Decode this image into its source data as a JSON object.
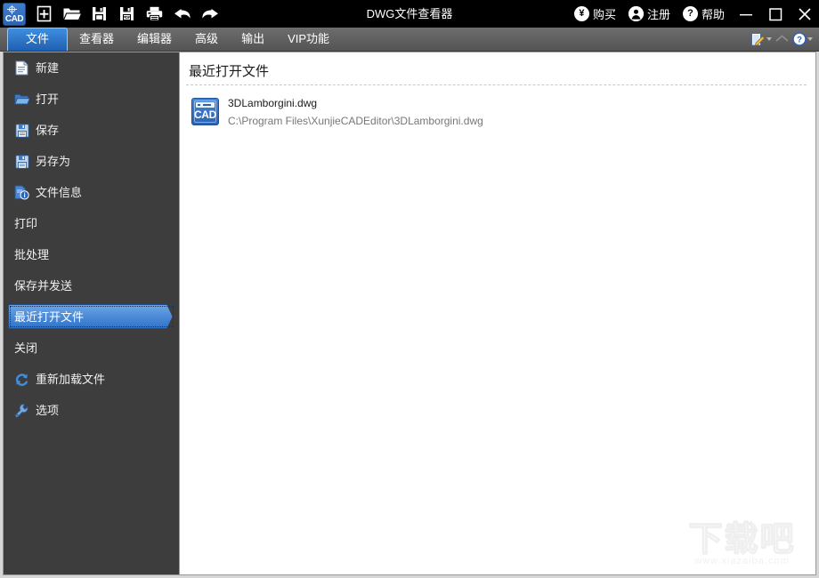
{
  "window": {
    "title": "DWG文件查看器",
    "logo_text": "CAD",
    "logo_name": "cad-app-logo"
  },
  "quick_access": [
    {
      "name": "new-file-button",
      "label": "新建",
      "icon": "new-document-icon"
    },
    {
      "name": "open-file-button",
      "label": "打开",
      "icon": "open-folder-icon"
    },
    {
      "name": "save-file-button",
      "label": "保存",
      "icon": "floppy-save-icon"
    },
    {
      "name": "save-pdf-button",
      "label": "保存为PDF",
      "icon": "floppy-pdf-icon"
    },
    {
      "name": "print-button",
      "label": "打印",
      "icon": "printer-icon"
    },
    {
      "name": "undo-button",
      "label": "撤销",
      "icon": "undo-arrow-icon"
    },
    {
      "name": "redo-button",
      "label": "重做",
      "icon": "redo-arrow-icon"
    }
  ],
  "titlebar_actions": [
    {
      "name": "purchase-button",
      "label": "购买",
      "icon": "yen-circle-icon"
    },
    {
      "name": "register-button",
      "label": "注册",
      "icon": "user-circle-icon"
    },
    {
      "name": "help-button",
      "label": "帮助",
      "icon": "question-circle-icon"
    }
  ],
  "window_controls": [
    {
      "name": "minimize-button",
      "icon": "minimize-icon"
    },
    {
      "name": "maximize-button",
      "icon": "maximize-icon"
    },
    {
      "name": "close-button",
      "icon": "close-icon"
    }
  ],
  "tabs": [
    {
      "name": "tab-file",
      "label": "文件",
      "active": true
    },
    {
      "name": "tab-viewer",
      "label": "查看器",
      "active": false
    },
    {
      "name": "tab-editor",
      "label": "编辑器",
      "active": false
    },
    {
      "name": "tab-advanced",
      "label": "高级",
      "active": false
    },
    {
      "name": "tab-output",
      "label": "输出",
      "active": false
    },
    {
      "name": "tab-vip",
      "label": "VIP功能",
      "active": false
    }
  ],
  "ribbon_right_icons": [
    {
      "name": "annotate-document-icon",
      "has_caret": true
    },
    {
      "name": "collapse-ribbon-chevron-icon",
      "has_caret": false
    },
    {
      "name": "help-question-icon",
      "has_caret": true
    }
  ],
  "sidebar": {
    "items": [
      {
        "name": "sidebar-item-new",
        "label": "新建",
        "icon": "new-document-icon",
        "selected": false
      },
      {
        "name": "sidebar-item-open",
        "label": "打开",
        "icon": "open-folder-icon",
        "selected": false
      },
      {
        "name": "sidebar-item-save",
        "label": "保存",
        "icon": "floppy-save-icon",
        "selected": false
      },
      {
        "name": "sidebar-item-save-as",
        "label": "另存为",
        "icon": "floppy-saveas-icon",
        "selected": false
      },
      {
        "name": "sidebar-item-file-info",
        "label": "文件信息",
        "icon": "document-info-icon",
        "selected": false
      },
      {
        "name": "sidebar-item-print",
        "label": "打印",
        "icon": "none",
        "selected": false
      },
      {
        "name": "sidebar-item-batch",
        "label": "批处理",
        "icon": "none",
        "selected": false
      },
      {
        "name": "sidebar-item-save-send",
        "label": "保存并发送",
        "icon": "none",
        "selected": false
      },
      {
        "name": "sidebar-item-recent",
        "label": "最近打开文件",
        "icon": "none",
        "selected": true
      },
      {
        "name": "sidebar-item-close",
        "label": "关闭",
        "icon": "none",
        "selected": false
      },
      {
        "name": "sidebar-item-reload",
        "label": "重新加载文件",
        "icon": "reload-icon",
        "selected": false
      },
      {
        "name": "sidebar-item-options",
        "label": "选项",
        "icon": "wrench-icon",
        "selected": false
      }
    ]
  },
  "main": {
    "title": "最近打开文件",
    "recent_files": [
      {
        "name": "3DLamborgini.dwg",
        "path": "C:\\Program Files\\XunjieCADEditor\\3DLamborgini.dwg",
        "icon_text": "CAD"
      }
    ]
  },
  "watermark": {
    "text": "下载吧",
    "url": "www.xiazaiba.com"
  },
  "colors": {
    "titlebar_bg": "#000000",
    "tabstrip_bg": "#5d5d5d",
    "tab_active": "#2f7fd0",
    "sidebar_bg": "#3d3d3d",
    "selection_blue": "#3f86dc",
    "content_bg": "#ffffff",
    "path_text": "#777777"
  }
}
